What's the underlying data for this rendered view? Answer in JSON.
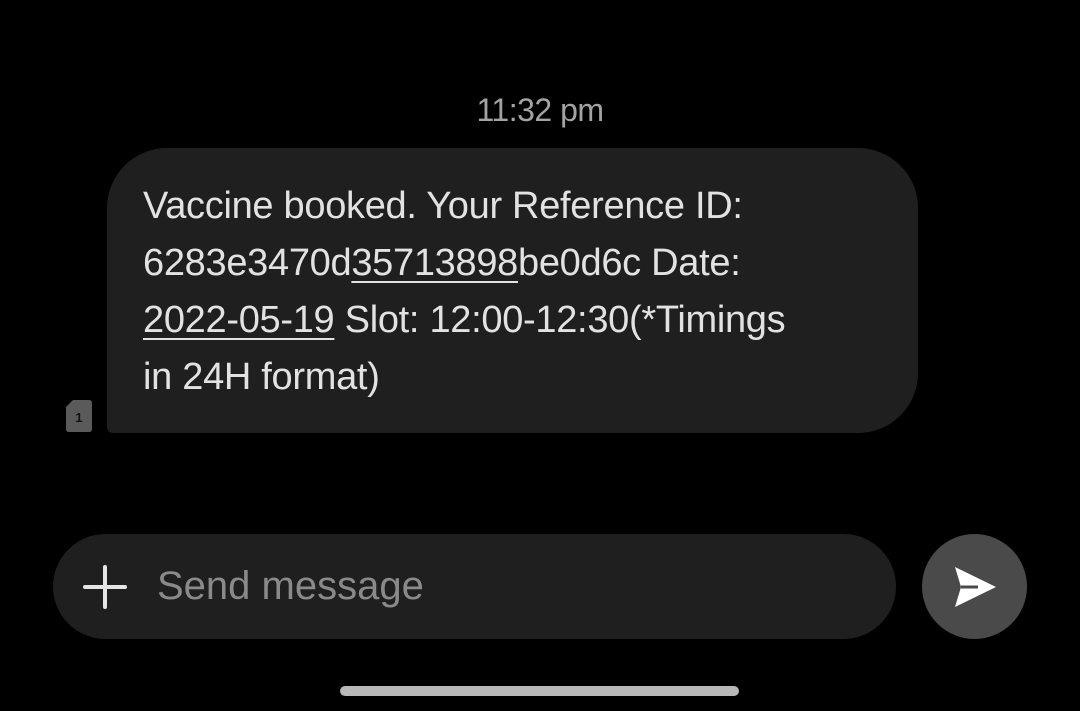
{
  "conversation": {
    "timestamp": "11:32 pm",
    "message": {
      "line1": "Vaccine booked. Your Reference ID:",
      "line2_prefix": "6283e3470d",
      "line2_link": "35713898",
      "line2_suffix": "be0d6c Date:",
      "line3_link": "2022-05-19",
      "line3_suffix": " Slot: 12:00-12:30(*Timings",
      "line4": "in 24H format)"
    },
    "sim_badge": "1"
  },
  "composer": {
    "placeholder": "Send message",
    "value": "",
    "add_icon": "plus-icon",
    "send_icon": "send-arrow-icon"
  },
  "colors": {
    "background": "#000000",
    "bubble": "#1f1f1f",
    "send_button": "#4a4a4a"
  }
}
